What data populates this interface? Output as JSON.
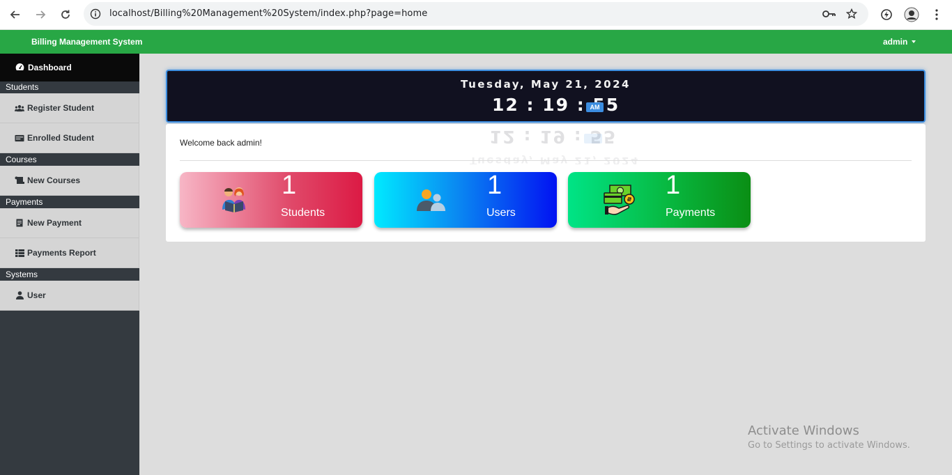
{
  "browser": {
    "url": "localhost/Billing%20Management%20System/index.php?page=home"
  },
  "navbar": {
    "brand": "Billing Management System",
    "user": "admin",
    "bg_color": "#28a745"
  },
  "sidebar": {
    "dashboard": "Dashboard",
    "sections": [
      {
        "header": "Students",
        "items": [
          "Register Student",
          "Enrolled Student"
        ]
      },
      {
        "header": "Courses",
        "items": [
          "New Courses"
        ]
      },
      {
        "header": "Payments",
        "items": [
          "New Payment",
          "Payments Report"
        ]
      },
      {
        "header": "Systems",
        "items": [
          "User"
        ]
      }
    ]
  },
  "clock": {
    "date": "Tuesday, May 21, 2024",
    "time": "12 : 19 : 55",
    "ampm": "AM"
  },
  "main": {
    "welcome": "Welcome back admin!",
    "stats": [
      {
        "count": "1",
        "label": "Students"
      },
      {
        "count": "1",
        "label": "Users"
      },
      {
        "count": "1",
        "label": "Payments"
      }
    ]
  },
  "watermark": {
    "title": "Activate Windows",
    "subtitle": "Go to Settings to activate Windows."
  }
}
